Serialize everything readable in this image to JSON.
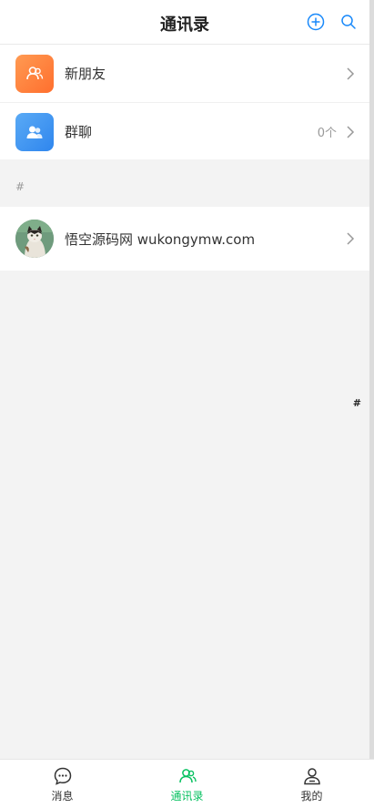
{
  "header": {
    "title": "通讯录",
    "add_icon": "plus-circle",
    "search_icon": "search"
  },
  "top_list": [
    {
      "label": "新朋友",
      "icon": "user-group",
      "count": ""
    },
    {
      "label": "群聊",
      "icon": "group-chat",
      "count": "0个"
    }
  ],
  "section": {
    "title": "#"
  },
  "contacts": [
    {
      "name": "悟空源码网 wukongymw.com",
      "avatar": "cat-photo"
    }
  ],
  "index_bar": {
    "hash": "#"
  },
  "tabbar": {
    "items": [
      {
        "label": "消息",
        "icon": "chat-bubble",
        "active": false
      },
      {
        "label": "通讯录",
        "icon": "contacts",
        "active": true
      },
      {
        "label": "我的",
        "icon": "profile",
        "active": false
      }
    ]
  },
  "colors": {
    "accent": "#07c160",
    "icon_blue": "#1989fa",
    "orange": "#ff7e3a",
    "blue": "#3a8ff0"
  }
}
